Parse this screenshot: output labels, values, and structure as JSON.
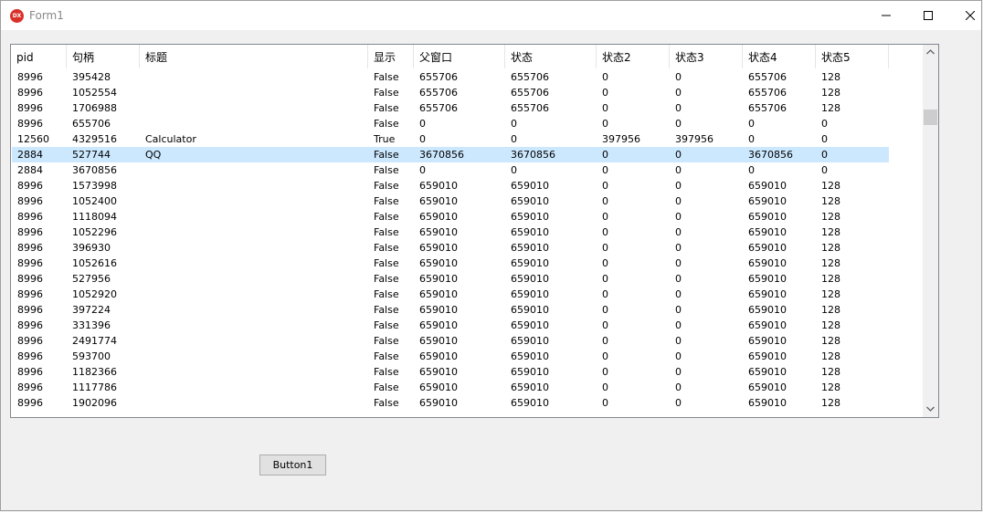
{
  "window": {
    "title": "Form1",
    "icon_text": "DX"
  },
  "list": {
    "columns": [
      "pid",
      "句柄",
      "标题",
      "显示",
      "父窗口",
      "状态",
      "状态2",
      "状态3",
      "状态4",
      "状态5"
    ],
    "selected_row": 5,
    "rows": [
      [
        "8996",
        "395428",
        "",
        "False",
        "655706",
        "655706",
        "0",
        "0",
        "655706",
        "128"
      ],
      [
        "8996",
        "1052554",
        "",
        "False",
        "655706",
        "655706",
        "0",
        "0",
        "655706",
        "128"
      ],
      [
        "8996",
        "1706988",
        "",
        "False",
        "655706",
        "655706",
        "0",
        "0",
        "655706",
        "128"
      ],
      [
        "8996",
        "655706",
        "",
        "False",
        "0",
        "0",
        "0",
        "0",
        "0",
        "0"
      ],
      [
        "12560",
        "4329516",
        "Calculator",
        "True",
        "0",
        "0",
        "397956",
        "397956",
        "0",
        "0"
      ],
      [
        "2884",
        "527744",
        "QQ",
        "False",
        "3670856",
        "3670856",
        "0",
        "0",
        "3670856",
        "0"
      ],
      [
        "2884",
        "3670856",
        "",
        "False",
        "0",
        "0",
        "0",
        "0",
        "0",
        "0"
      ],
      [
        "8996",
        "1573998",
        "",
        "False",
        "659010",
        "659010",
        "0",
        "0",
        "659010",
        "128"
      ],
      [
        "8996",
        "1052400",
        "",
        "False",
        "659010",
        "659010",
        "0",
        "0",
        "659010",
        "128"
      ],
      [
        "8996",
        "1118094",
        "",
        "False",
        "659010",
        "659010",
        "0",
        "0",
        "659010",
        "128"
      ],
      [
        "8996",
        "1052296",
        "",
        "False",
        "659010",
        "659010",
        "0",
        "0",
        "659010",
        "128"
      ],
      [
        "8996",
        "396930",
        "",
        "False",
        "659010",
        "659010",
        "0",
        "0",
        "659010",
        "128"
      ],
      [
        "8996",
        "1052616",
        "",
        "False",
        "659010",
        "659010",
        "0",
        "0",
        "659010",
        "128"
      ],
      [
        "8996",
        "527956",
        "",
        "False",
        "659010",
        "659010",
        "0",
        "0",
        "659010",
        "128"
      ],
      [
        "8996",
        "1052920",
        "",
        "False",
        "659010",
        "659010",
        "0",
        "0",
        "659010",
        "128"
      ],
      [
        "8996",
        "397224",
        "",
        "False",
        "659010",
        "659010",
        "0",
        "0",
        "659010",
        "128"
      ],
      [
        "8996",
        "331396",
        "",
        "False",
        "659010",
        "659010",
        "0",
        "0",
        "659010",
        "128"
      ],
      [
        "8996",
        "2491774",
        "",
        "False",
        "659010",
        "659010",
        "0",
        "0",
        "659010",
        "128"
      ],
      [
        "8996",
        "593700",
        "",
        "False",
        "659010",
        "659010",
        "0",
        "0",
        "659010",
        "128"
      ],
      [
        "8996",
        "1182366",
        "",
        "False",
        "659010",
        "659010",
        "0",
        "0",
        "659010",
        "128"
      ],
      [
        "8996",
        "1117786",
        "",
        "False",
        "659010",
        "659010",
        "0",
        "0",
        "659010",
        "128"
      ],
      [
        "8996",
        "1902096",
        "",
        "False",
        "659010",
        "659010",
        "0",
        "0",
        "659010",
        "128"
      ]
    ]
  },
  "button1": {
    "label": "Button1"
  },
  "colors": {
    "selected_row": "#cce8ff",
    "icon_red": "#d9302a"
  },
  "icons": {
    "app": "app-logo-icon",
    "minimize": "minimize-icon",
    "maximize": "maximize-icon",
    "close": "close-icon",
    "scroll_up": "chevron-up-icon",
    "scroll_down": "chevron-down-icon"
  }
}
